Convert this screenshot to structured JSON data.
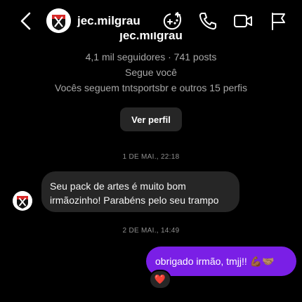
{
  "header": {
    "username": "jec.milgrau",
    "icons": [
      "back-arrow-icon",
      "gamepad-icon",
      "phone-call-icon",
      "video-call-icon",
      "flag-icon"
    ]
  },
  "profile": {
    "name": "jec.milgrau",
    "stats": "4,1 mil seguidores · 741 posts",
    "follows_you": "Segue você",
    "mutuals": "Vocês seguem tntsportsbr e outros 15 perfis",
    "view_profile_label": "Ver perfil"
  },
  "messages": [
    {
      "timestamp": "1 DE MAI., 22:18",
      "direction": "incoming",
      "line1": "Seu pack de artes é muito bom",
      "line2": "irmãozinho! Parabéns pelo seu trampo"
    },
    {
      "timestamp": "2 DE MAI., 14:49",
      "direction": "outgoing",
      "text": "obrigado irmão, tmjj!! 💪🏾🤝🏽",
      "reaction": "❤️"
    }
  ],
  "colors": {
    "background": "#000000",
    "incoming_bubble": "#262626",
    "outgoing_bubble": "#7a1fe6",
    "secondary_text": "#a8a8a8",
    "heart": "#ff3040"
  }
}
